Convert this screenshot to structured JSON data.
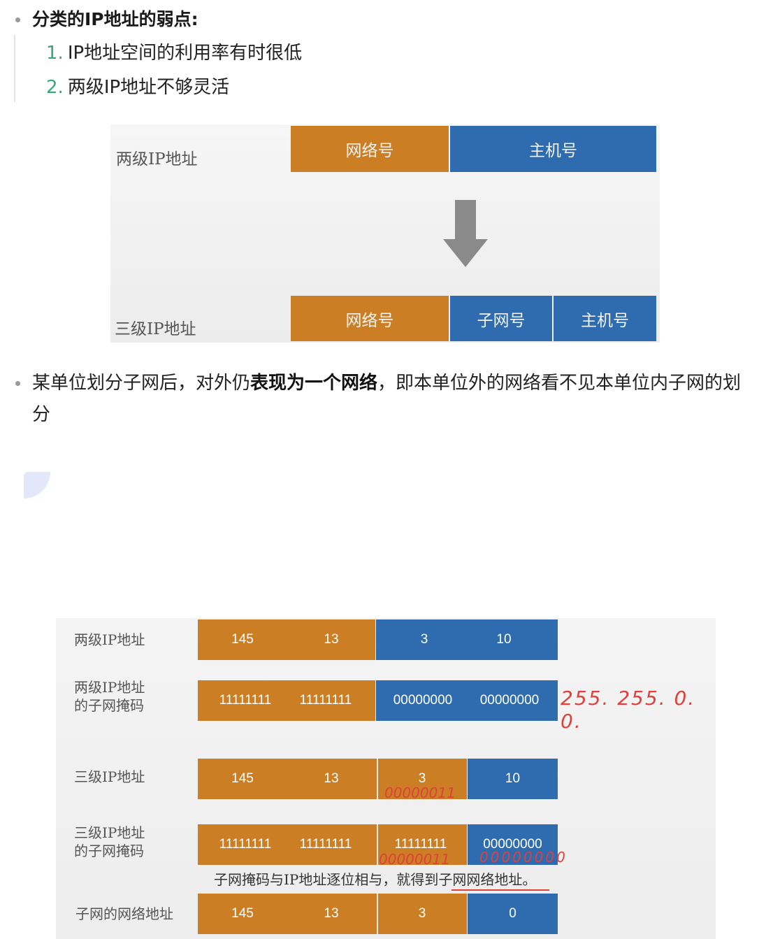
{
  "section": {
    "title": "分类的IP地址的弱点:",
    "items": [
      {
        "num": "1.",
        "text": "IP地址空间的利用率有时很低"
      },
      {
        "num": "2.",
        "text": "两级IP地址不够灵活"
      }
    ]
  },
  "figure1": {
    "two_level_label": "两级IP地址",
    "three_level_label": "三级IP地址",
    "two_level_segments": {
      "network": "网络号",
      "host": "主机号"
    },
    "three_level_segments": {
      "network": "网络号",
      "subnet": "子网号",
      "host": "主机号"
    },
    "colors": {
      "network": "#cc7e24",
      "host": "#2e6caf",
      "arrow": "#8a8a8a"
    }
  },
  "paragraph": {
    "before": "某单位划分子网后，对外仍",
    "bold": "表现为一个网络",
    "after": "，即本单位外的网络看不见本单位内子网的划分"
  },
  "figure2": {
    "rows": [
      {
        "label": "两级IP地址",
        "cells": [
          "145",
          "13",
          "3",
          "10"
        ]
      },
      {
        "label": "两级IP地址\n的子网掩码",
        "cells": [
          "11111111",
          "11111111",
          "00000000",
          "00000000"
        ]
      },
      {
        "label": "三级IP地址",
        "cells": [
          "145",
          "13",
          "3",
          "10"
        ]
      },
      {
        "label": "三级IP地址\n的子网掩码",
        "cells": [
          "11111111",
          "11111111",
          "11111111",
          "00000000"
        ]
      },
      {
        "label": "子网的网络地址",
        "cells": [
          "145",
          "13",
          "3",
          "0"
        ]
      }
    ],
    "caption": "子网掩码与IP地址逐位相与，就得到子网网络地址。",
    "handwriting": {
      "mask_decimal": "255. 255. 0. 0.",
      "third_octet_binary": "00000011",
      "third_octet_binary_and": "00000011",
      "fourth_octet_zero": "00000000"
    }
  }
}
